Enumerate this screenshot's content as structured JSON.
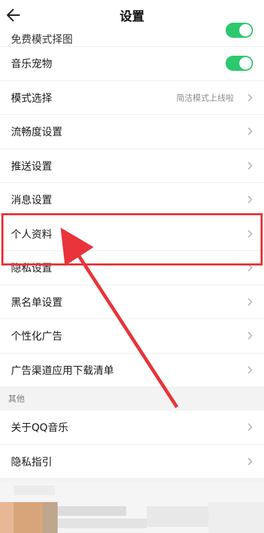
{
  "header": {
    "title": "设置"
  },
  "partial_item": {
    "label": "免费模式择图"
  },
  "items": [
    {
      "label": "音乐宠物",
      "control": "toggle",
      "value": ""
    },
    {
      "label": "模式选择",
      "control": "chevron",
      "value": "简洁模式上线啦"
    },
    {
      "label": "流畅度设置",
      "control": "chevron",
      "value": ""
    },
    {
      "label": "推送设置",
      "control": "chevron",
      "value": ""
    },
    {
      "label": "消息设置",
      "control": "chevron",
      "value": ""
    },
    {
      "label": "个人资料",
      "control": "chevron",
      "value": ""
    },
    {
      "label": "隐私设置",
      "control": "chevron",
      "value": ""
    },
    {
      "label": "黑名单设置",
      "control": "chevron",
      "value": ""
    },
    {
      "label": "个性化广告",
      "control": "chevron",
      "value": ""
    },
    {
      "label": "广告渠道应用下载清单",
      "control": "chevron",
      "value": ""
    }
  ],
  "other_section": {
    "header": "其他",
    "items": [
      {
        "label": "关于QQ音乐"
      },
      {
        "label": "隐私指引"
      }
    ]
  },
  "colors": {
    "toggle_on": "#2cc86e",
    "highlight": "#e8343a",
    "accent": "#2cc86e"
  },
  "icons": {
    "back": "arrow-left-icon",
    "chevron": "chevron-right-icon"
  }
}
